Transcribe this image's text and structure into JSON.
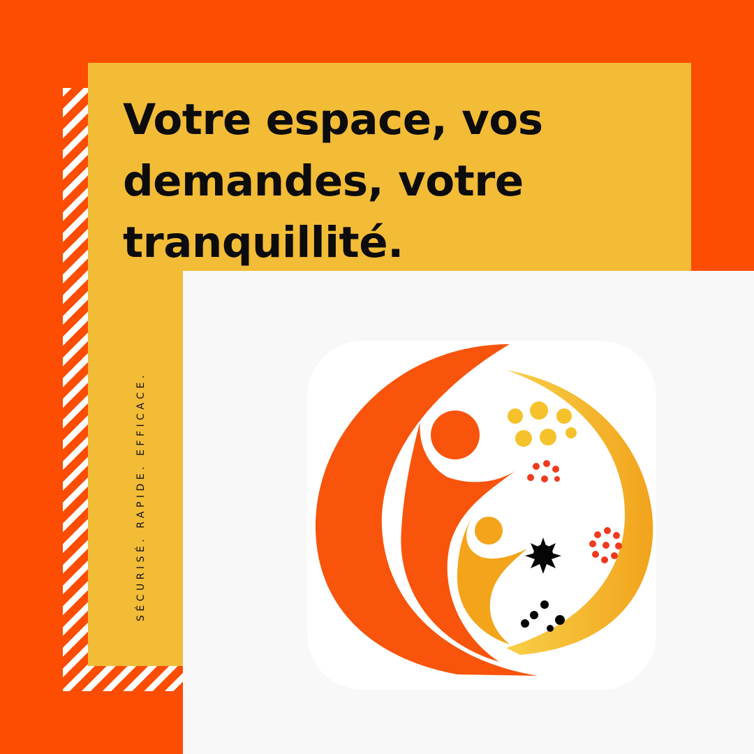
{
  "colors": {
    "background": "#fc4d02",
    "panel_yellow": "#f3bc36",
    "panel_white": "#f8f8f8",
    "logo_orange": "#f9540c",
    "logo_gold": "#f3a41b",
    "logo_yellow": "#f6c22b",
    "logo_red": "#f0391f",
    "logo_black": "#050505"
  },
  "headline": {
    "line1": "Votre espace, vos",
    "line2": "demandes, votre",
    "line3": "tranquillité."
  },
  "tagline": "SÉCURISÉ. RAPIDE. EFFICACE.",
  "logo": {
    "icon": "family-circle-logo"
  }
}
